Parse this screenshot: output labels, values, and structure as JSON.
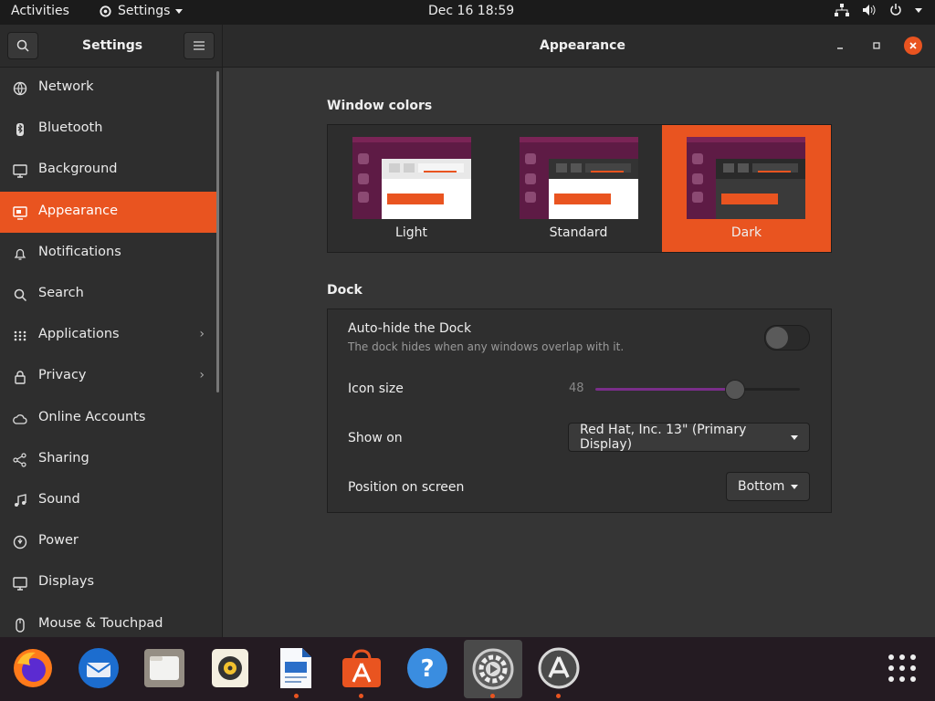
{
  "topbar": {
    "activities": "Activities",
    "app_menu": "Settings",
    "clock": "Dec 16  18:59",
    "icons": [
      "network-icon",
      "volume-icon",
      "power-icon",
      "menu-arrow-icon"
    ]
  },
  "header": {
    "sidebar_title": "Settings",
    "main_title": "Appearance",
    "search_icon": "search-icon",
    "menu_icon": "hamburger-menu-icon"
  },
  "sidebar": {
    "items": [
      {
        "label": "Network",
        "icon": "network-globe-icon"
      },
      {
        "label": "Bluetooth",
        "icon": "bluetooth-icon"
      },
      {
        "label": "Background",
        "icon": "background-display-icon"
      },
      {
        "label": "Appearance",
        "icon": "appearance-icon",
        "active": true
      },
      {
        "label": "Notifications",
        "icon": "bell-icon"
      },
      {
        "label": "Search",
        "icon": "search-icon"
      },
      {
        "label": "Applications",
        "icon": "grid-icon",
        "chevron": true
      },
      {
        "label": "Privacy",
        "icon": "lock-icon",
        "chevron": true
      },
      {
        "label": "Online Accounts",
        "icon": "cloud-icon"
      },
      {
        "label": "Sharing",
        "icon": "share-icon"
      },
      {
        "label": "Sound",
        "icon": "music-note-icon"
      },
      {
        "label": "Power",
        "icon": "power-icon"
      },
      {
        "label": "Displays",
        "icon": "display-icon"
      },
      {
        "label": "Mouse & Touchpad",
        "icon": "mouse-icon"
      }
    ]
  },
  "appearance": {
    "window_colors_title": "Window colors",
    "options": [
      {
        "label": "Light",
        "selected": false
      },
      {
        "label": "Standard",
        "selected": false
      },
      {
        "label": "Dark",
        "selected": true
      }
    ],
    "dock_title": "Dock",
    "auto_hide_label": "Auto-hide the Dock",
    "auto_hide_sub": "The dock hides when any windows overlap with it.",
    "auto_hide_on": false,
    "icon_size_label": "Icon size",
    "icon_size_value": "48",
    "icon_size_fraction": 0.68,
    "show_on_label": "Show on",
    "show_on_value": "Red Hat, Inc. 13\" (Primary Display)",
    "position_label": "Position on screen",
    "position_value": "Bottom"
  },
  "dock": {
    "apps": [
      {
        "name": "firefox-icon",
        "running": false
      },
      {
        "name": "thunderbird-icon",
        "running": false
      },
      {
        "name": "files-icon",
        "running": false
      },
      {
        "name": "rhythmbox-icon",
        "running": false
      },
      {
        "name": "libreoffice-writer-icon",
        "running": true
      },
      {
        "name": "software-center-icon",
        "running": true
      },
      {
        "name": "help-icon",
        "running": false
      },
      {
        "name": "settings-icon",
        "running": true,
        "active": true
      },
      {
        "name": "software-updater-icon",
        "running": true
      }
    ],
    "show_apps_icon": "app-grid-icon"
  },
  "colors": {
    "accent": "#e95420",
    "aubergine": "#5e1b45"
  }
}
